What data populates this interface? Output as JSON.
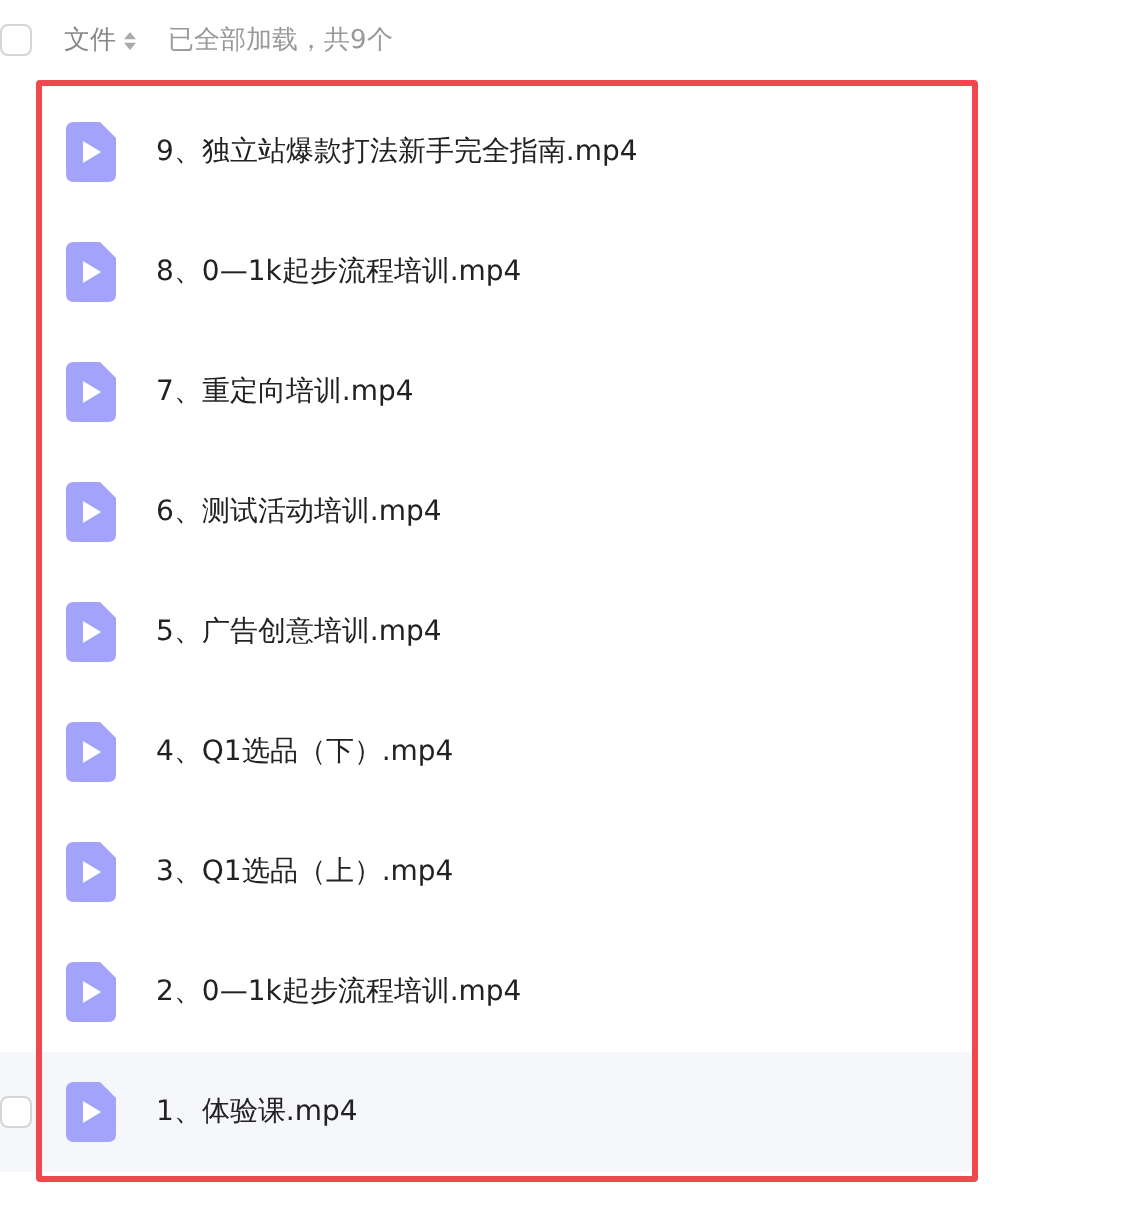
{
  "header": {
    "checked": false,
    "column": "文件",
    "status": "已全部加载，共9个"
  },
  "files": [
    {
      "name": "9、独立站爆款打法新手完全指南.mp4",
      "hovered": false
    },
    {
      "name": "8、0—1k起步流程培训.mp4",
      "hovered": false
    },
    {
      "name": "7、重定向培训.mp4",
      "hovered": false
    },
    {
      "name": "6、测试活动培训.mp4",
      "hovered": false
    },
    {
      "name": "5、广告创意培训.mp4",
      "hovered": false
    },
    {
      "name": "4、Q1选品（下）.mp4",
      "hovered": false
    },
    {
      "name": "3、Q1选品（上）.mp4",
      "hovered": false
    },
    {
      "name": "2、0—1k起步流程培训.mp4",
      "hovered": false
    },
    {
      "name": "1、体验课.mp4",
      "hovered": true,
      "checked": false
    }
  ]
}
